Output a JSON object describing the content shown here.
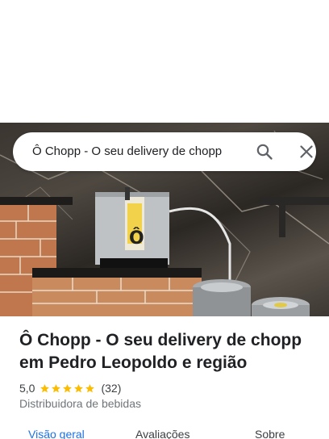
{
  "search": {
    "value": "Ô Chopp - O seu delivery de chopp"
  },
  "place": {
    "title": "Ô Chopp - O seu delivery de chopp em Pedro Leopoldo e região",
    "rating": "5,0",
    "stars": 5,
    "reviews": "(32)",
    "category": "Distribuidora de bebidas"
  },
  "tabs": [
    {
      "label": "Visão geral",
      "active": true
    },
    {
      "label": "Avaliações",
      "active": false
    },
    {
      "label": "Sobre",
      "active": false
    }
  ],
  "colors": {
    "accent": "#1a73e8",
    "star": "#fbbc04"
  },
  "icons": {
    "search": "search-icon",
    "close": "close-icon"
  }
}
